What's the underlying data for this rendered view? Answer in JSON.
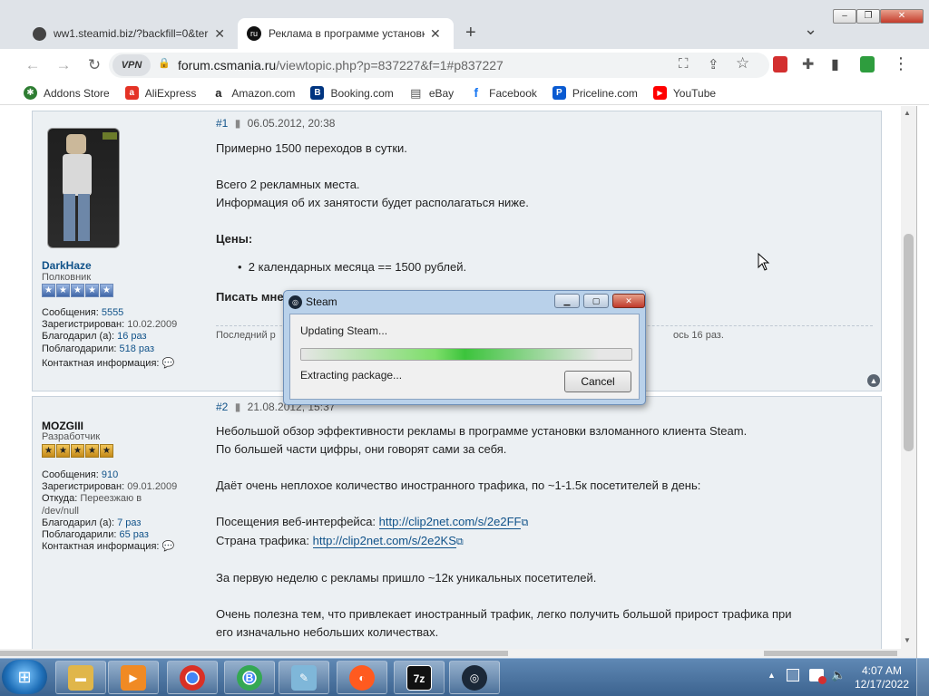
{
  "window": {
    "min": "–",
    "max": "❐",
    "close": "✕"
  },
  "tabs": [
    {
      "title": "ww1.steamid.biz/?backfill=0&ter",
      "close": "✕"
    },
    {
      "title": "Реклама в программе установк",
      "close": "✕"
    }
  ],
  "new_tab": "+",
  "tab_menu": "⌄",
  "nav": {
    "back": "←",
    "forward": "→",
    "reload": "↻",
    "vpn": "VPN",
    "lock": "🔒"
  },
  "url": {
    "host": "forum.csmania.ru",
    "path": "/viewtopic.php?p=837227&f=1#p837227"
  },
  "toolbar_icons": {
    "translate": "⛶",
    "share": "⇪",
    "star": "☆",
    "extensions": "✚",
    "sidebar": "▮",
    "menu": "⋮"
  },
  "bookmarks": [
    {
      "label": "Addons Store",
      "icon": "puzzle-icon",
      "color": "#2e7d32",
      "glyph": "✱"
    },
    {
      "label": "AliExpress",
      "icon": "aliexpress-icon",
      "color": "#e43225",
      "glyph": "a"
    },
    {
      "label": "Amazon.com",
      "icon": "amazon-icon",
      "color": "#222222",
      "glyph": "a"
    },
    {
      "label": "Booking.com",
      "icon": "booking-icon",
      "color": "#003580",
      "glyph": "B"
    },
    {
      "label": "eBay",
      "icon": "ebay-icon",
      "color": "#555555",
      "glyph": "▤"
    },
    {
      "label": "Facebook",
      "icon": "facebook-icon",
      "color": "#1877f2",
      "glyph": "f"
    },
    {
      "label": "Priceline.com",
      "icon": "priceline-icon",
      "color": "#0a5ad1",
      "glyph": "P"
    },
    {
      "label": "YouTube",
      "icon": "youtube-icon",
      "color": "#ff0000",
      "glyph": "▶"
    }
  ],
  "posts": [
    {
      "number": "#1",
      "date": "06.05.2012, 20:38",
      "author": "DarkHaze",
      "rank": "Полковник",
      "stats": [
        {
          "label": "Сообщения:",
          "value": "5555"
        },
        {
          "label": "Зарегистрирован:",
          "value": "10.02.2009"
        },
        {
          "label": "Благодарил (а):",
          "value": "16 раз"
        },
        {
          "label": "Поблагодарили:",
          "value": "518 раз"
        }
      ],
      "contact": "Контактная информация:",
      "lines": [
        "Примерно 1500 переходов в сутки.",
        "Всего 2 рекламных места.",
        "Информация об их занятости будет располагаться ниже."
      ],
      "prices_heading": "Цены:",
      "price_item": "2 календарных месяца == 1500 рублей.",
      "write_partial": "Писать мне",
      "footer_partial_left": "Последний р",
      "footer_partial_right": "ось 16 раз."
    },
    {
      "number": "#2",
      "date": "21.08.2012, 15:37",
      "author": "MOZGIII",
      "rank": "Разработчик",
      "stats": [
        {
          "label": "Сообщения:",
          "value": "910"
        },
        {
          "label": "Зарегистрирован:",
          "value": "09.01.2009"
        },
        {
          "label": "Откуда:",
          "value": "Переезжаю в /dev/null"
        },
        {
          "label": "Благодарил (а):",
          "value": "7 раз"
        },
        {
          "label": "Поблагодарили:",
          "value": "65 раз"
        }
      ],
      "contact": "Контактная информация:",
      "p1a": "Небольшой обзор эффективности рекламы в программе установки взломанного клиента Steam.",
      "p1b": "По большей части цифры, они говорят сами за себя.",
      "p2": "Даёт очень неплохое количество иностранного трафика, по ~1-1.5к посетителей в день:",
      "visits_label": "Посещения веб-интерфейса:",
      "visits_link": "http://clip2net.com/s/2e2FF",
      "country_label": "Страна трафика:",
      "country_link": "http://clip2net.com/s/2e2KS",
      "p3": "За первую неделю с рекламы пришло ~12к уникальных посетителей.",
      "p4a": "Очень полезна тем, что привлекает иностранный трафик, легко получить большой прирост трафика при",
      "p4b": "его изначально небольших количествах."
    }
  ],
  "steam_dialog": {
    "title": "Steam",
    "status": "Updating Steam...",
    "substatus": "Extracting package...",
    "cancel": "Cancel",
    "progress": 0.45
  },
  "taskbar": {
    "apps": [
      {
        "name": "explorer",
        "color": "#e0b64a",
        "glyph": "▬"
      },
      {
        "name": "media",
        "color": "#f08a24",
        "glyph": "▶"
      },
      {
        "name": "chrome",
        "color": "#d93025",
        "glyph": "◉"
      },
      {
        "name": "chrome-b",
        "color": "#34a853",
        "glyph": "B"
      },
      {
        "name": "notepad",
        "color": "#7fb7d9",
        "glyph": "✎"
      },
      {
        "name": "yandex",
        "color": "#ff5a1f",
        "glyph": "◐"
      },
      {
        "name": "7zip",
        "color": "#111111",
        "glyph": "7z"
      },
      {
        "name": "steam",
        "color": "#1b2838",
        "glyph": "◎"
      }
    ],
    "time": "4:07 AM",
    "date": "12/17/2022"
  }
}
